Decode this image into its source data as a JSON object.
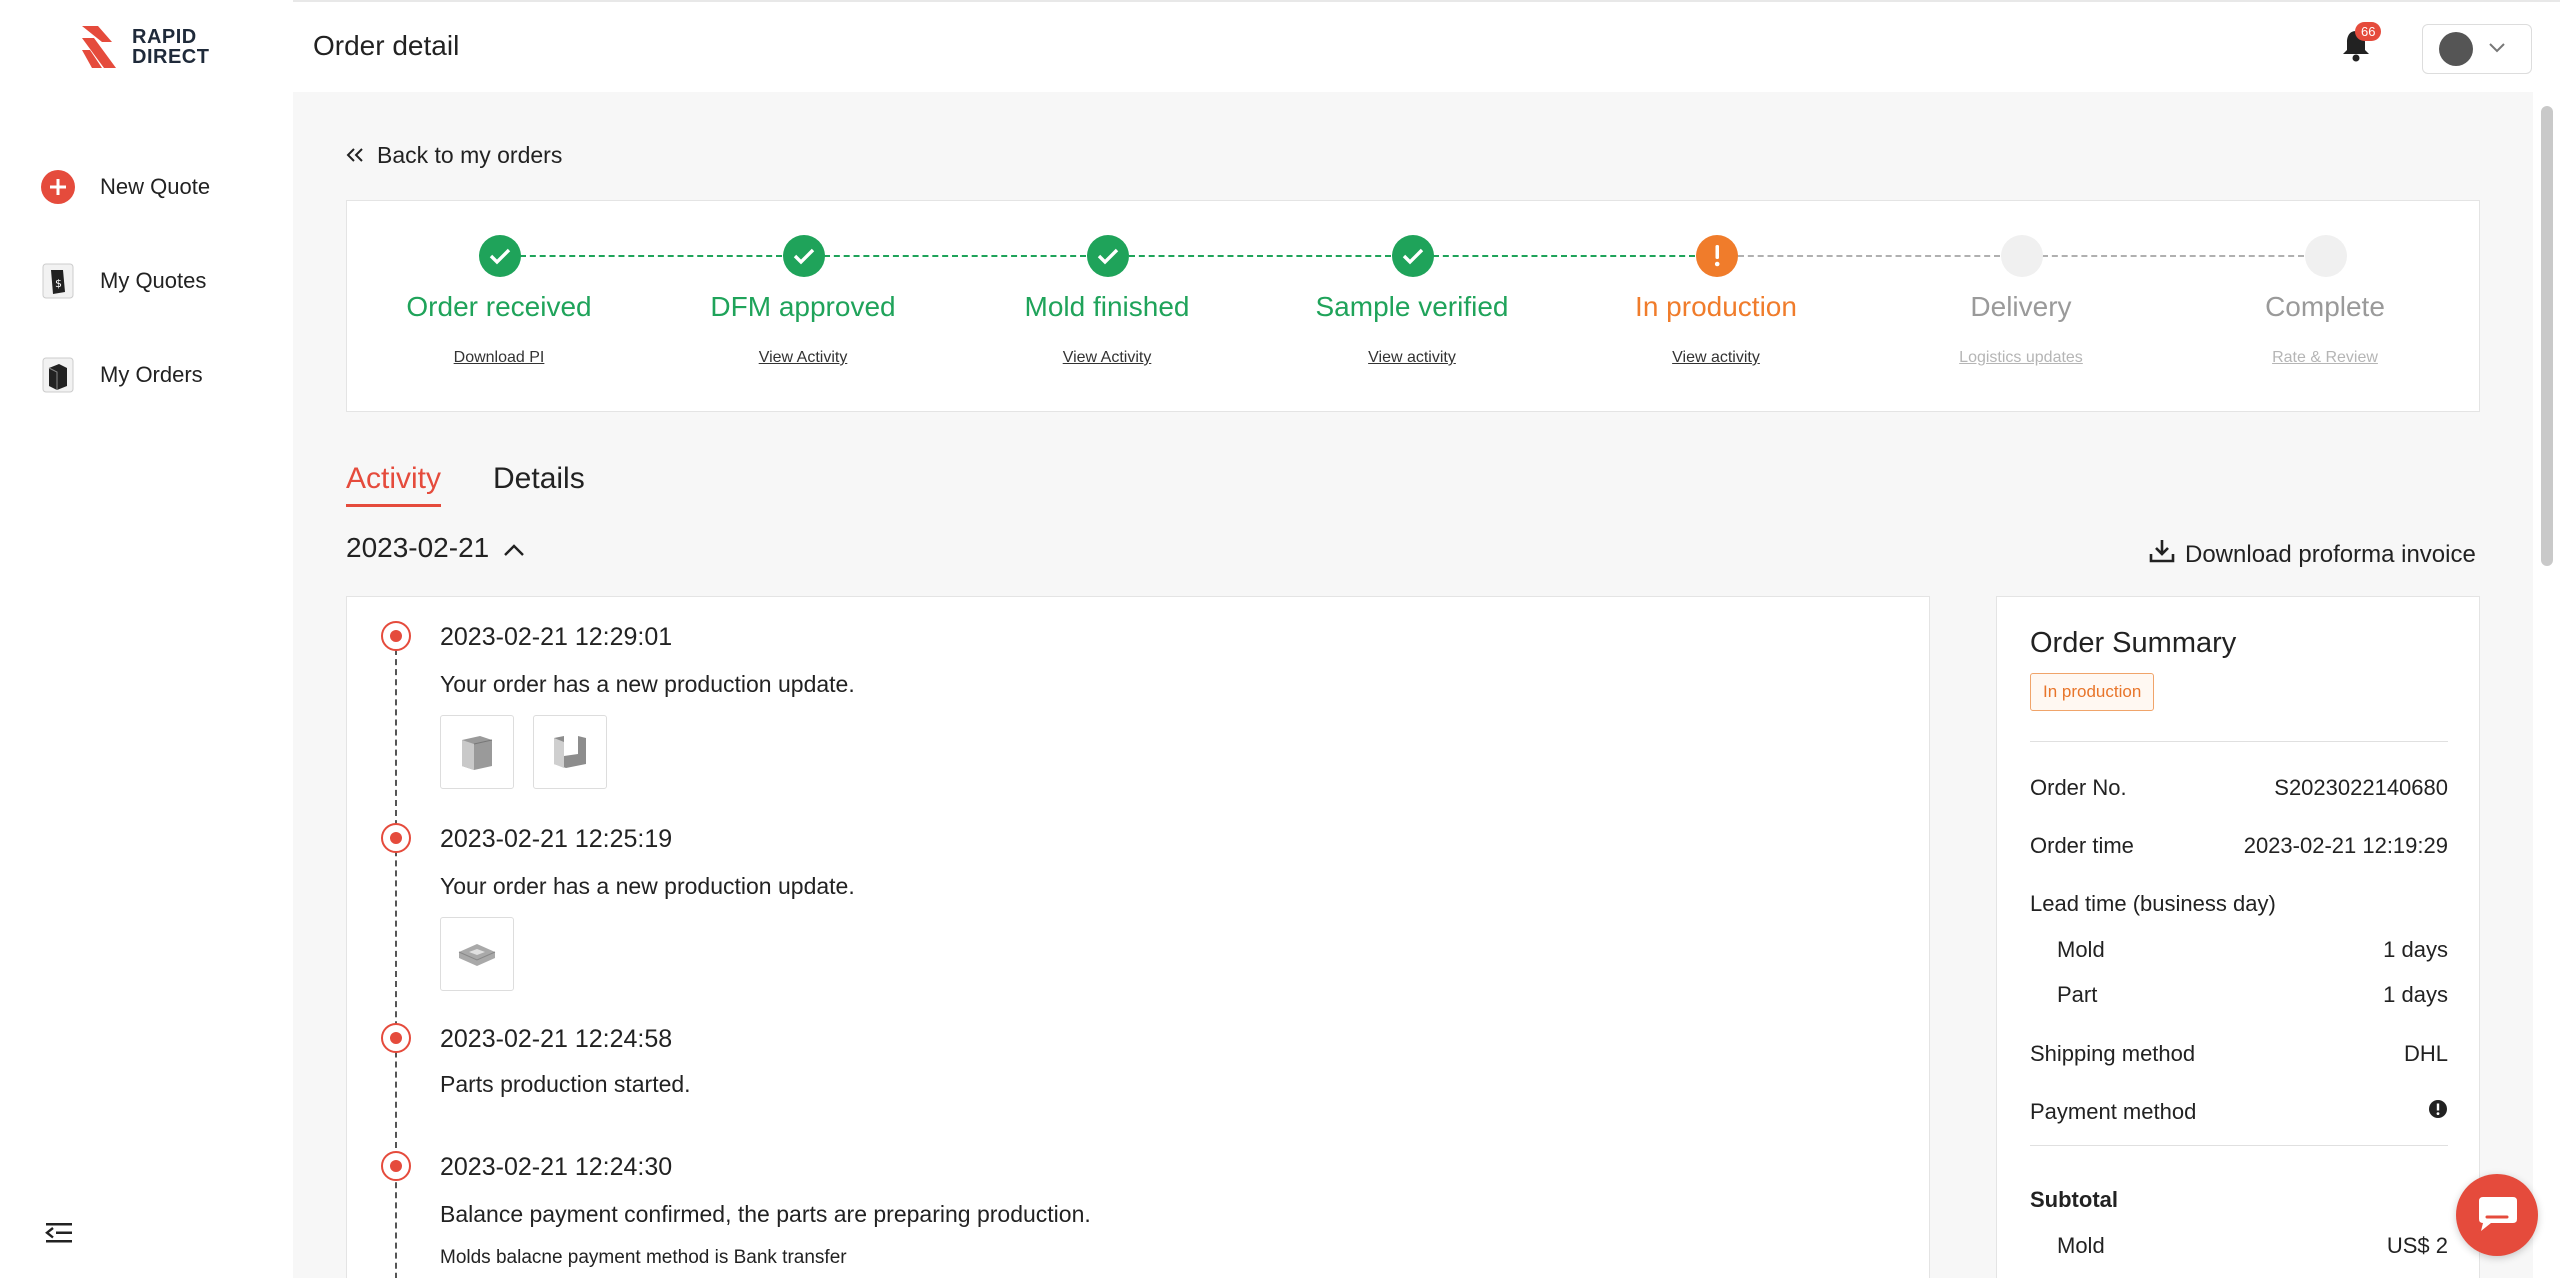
{
  "brand": {
    "name_line1": "RAPID",
    "name_line2": "DIRECT"
  },
  "sidebar": {
    "items": [
      {
        "label": "New Quote",
        "icon": "plus-circle-icon"
      },
      {
        "label": "My Quotes",
        "icon": "quotes-doc-icon"
      },
      {
        "label": "My Orders",
        "icon": "orders-doc-icon"
      }
    ]
  },
  "header": {
    "title": "Order detail",
    "notification_count": "66"
  },
  "back_link": "Back to my orders",
  "steps": [
    {
      "title": "Order received",
      "link": "Download PI",
      "status": "done"
    },
    {
      "title": "DFM approved",
      "link": "View Activity",
      "status": "done"
    },
    {
      "title": "Mold finished",
      "link": "View Activity",
      "status": "done"
    },
    {
      "title": "Sample verified",
      "link": "View activity",
      "status": "done"
    },
    {
      "title": "In production",
      "link": "View activity",
      "status": "current"
    },
    {
      "title": "Delivery",
      "link": "Logistics updates",
      "status": "pending"
    },
    {
      "title": "Complete",
      "link": "Rate & Review",
      "status": "pending"
    }
  ],
  "tabs": [
    {
      "label": "Activity",
      "active": true
    },
    {
      "label": "Details",
      "active": false
    }
  ],
  "activity": {
    "date": "2023-02-21",
    "download_label": "Download proforma invoice",
    "entries": [
      {
        "time": "2023-02-21 12:29:01",
        "message": "Your order has a new production update."
      },
      {
        "time": "2023-02-21 12:25:19",
        "message": "Your order has a new production update."
      },
      {
        "time": "2023-02-21 12:24:58",
        "message": "Parts production started."
      },
      {
        "time": "2023-02-21 12:24:30",
        "message": "Balance payment confirmed, the parts are preparing production.",
        "note": "Molds balacne payment method is Bank transfer"
      }
    ]
  },
  "summary": {
    "title": "Order Summary",
    "status_badge": "In production",
    "order_no_label": "Order No.",
    "order_no": "S2023022140680",
    "order_time_label": "Order time",
    "order_time": "2023-02-21 12:19:29",
    "lead_time_label": "Lead time (business day)",
    "mold_label": "Mold",
    "mold_lead": "1 days",
    "part_label": "Part",
    "part_lead": "1 days",
    "shipping_label": "Shipping method",
    "shipping": "DHL",
    "payment_label": "Payment method",
    "subtotal_label": "Subtotal",
    "subtotal_mold_label": "Mold",
    "subtotal_mold": "US$ 2"
  },
  "colors": {
    "accent": "#e54b3c",
    "done": "#1fa35a",
    "current": "#f07c2b"
  }
}
